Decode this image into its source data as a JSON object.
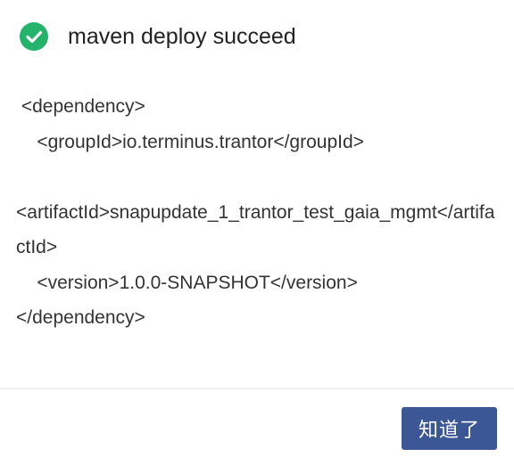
{
  "dialog": {
    "title": "maven deploy succeed",
    "icon": "check-circle-icon",
    "success_color": "#24b36b",
    "lines": [
      " <dependency>",
      "    <groupId>io.terminus.trantor</groupId>",
      "",
      "<artifactId>snapupdate_1_trantor_test_gaia_mgmt</artifactId>",
      "    <version>1.0.0-SNAPSHOT</version>",
      "</dependency>"
    ],
    "ok_label": "知道了",
    "button_color": "#3b5795"
  }
}
